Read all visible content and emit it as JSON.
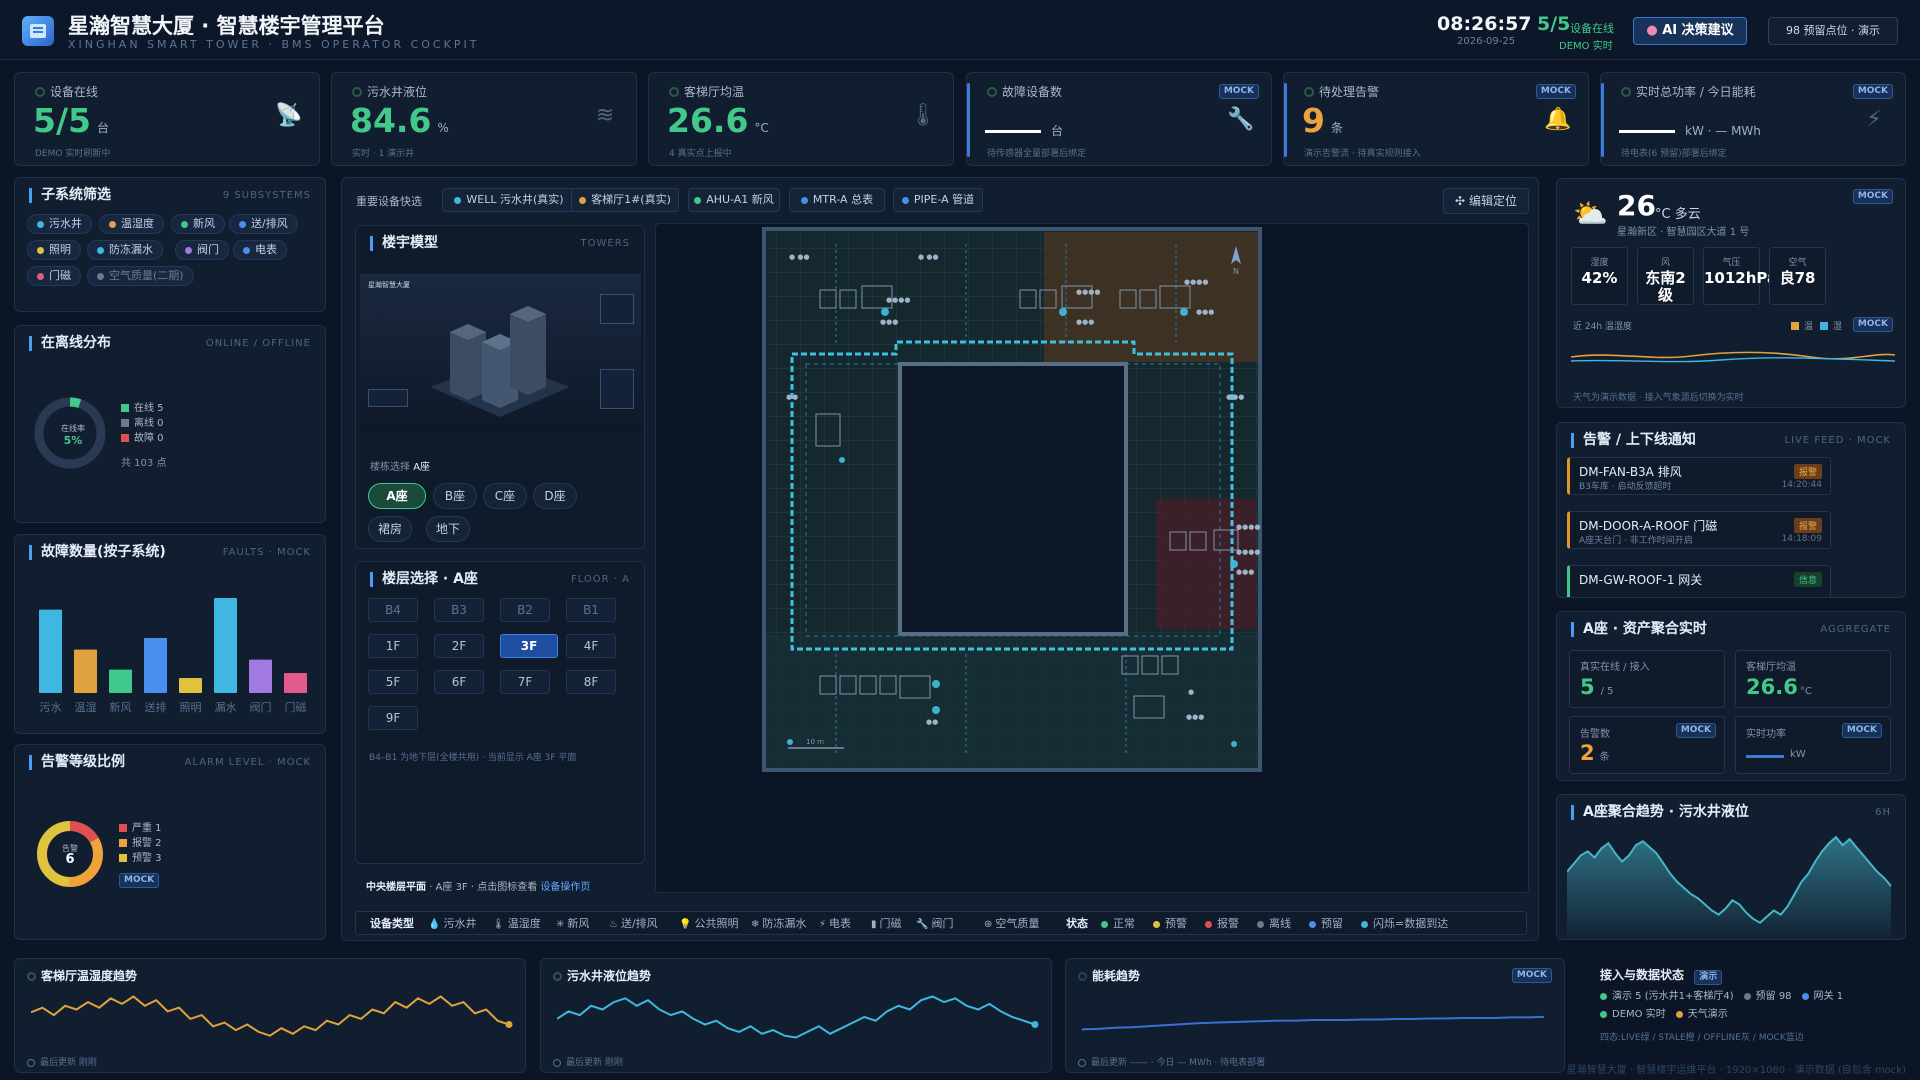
{
  "header": {
    "title": "星瀚智慧大厦 · 智慧楼宇管理平台",
    "subtitle": "XINGHAN SMART TOWER · BMS OPERATOR COCKPIT",
    "time": "08:26:57",
    "date": "2026-09-25",
    "online_ratio": "5/5",
    "online_label": "设备在线",
    "online_sub": "DEMO 实时",
    "ai_button": "AI 决策建议",
    "demo_button": "98 预留点位 · 演示"
  },
  "kpis": [
    {
      "label": "设备在线",
      "value": "5/5",
      "unit": "台",
      "foot": "DEMO 实时刷新中",
      "color": "#42c98a",
      "icon": "satellite-icon"
    },
    {
      "label": "污水井液位",
      "value": "84.6",
      "unit": "%",
      "foot": "实时 · 1 演示井",
      "color": "#42c98a",
      "icon": "water-icon"
    },
    {
      "label": "客梯厅均温",
      "value": "26.6",
      "unit": "°C",
      "foot": "4 真实点上报中",
      "color": "#42c98a",
      "icon": "thermometer-icon"
    },
    {
      "label": "故障设备数",
      "value": "",
      "unit": "台",
      "foot": "待传感器全量部署后绑定",
      "mock": "MOCK",
      "icon": "wrench-icon"
    },
    {
      "label": "待处理告警",
      "value": "9",
      "unit": "条",
      "foot": "演示告警流 · 待真实规则接入",
      "mock": "MOCK",
      "color": "#f0a23a",
      "icon": "bell-icon"
    },
    {
      "label": "实时总功率 / 今日能耗",
      "value": "",
      "unit": "kW · — MWh",
      "foot": "待电表(6 预留)部署后绑定",
      "mock": "MOCK",
      "icon": "lightning-icon"
    }
  ],
  "subsystem_filter": {
    "title": "子系统筛选",
    "sub": "9 SUBSYSTEMS",
    "chips": [
      {
        "label": "污水井",
        "color": "#3fb7e0"
      },
      {
        "label": "温湿度",
        "color": "#e0a23f"
      },
      {
        "label": "新风",
        "color": "#3fc98a"
      },
      {
        "label": "送/排风",
        "color": "#4a8ff0"
      },
      {
        "label": "照明",
        "color": "#e0c23f"
      },
      {
        "label": "防冻漏水",
        "color": "#3fb7e0"
      },
      {
        "label": "阀门",
        "color": "#a07ae0"
      },
      {
        "label": "电表",
        "color": "#4a8ff0"
      },
      {
        "label": "门磁",
        "color": "#e05a8a"
      },
      {
        "label": "空气质量(二期)",
        "color": "#6b7a90"
      }
    ]
  },
  "online_dist": {
    "title": "在离线分布",
    "sub": "ONLINE / OFFLINE",
    "donut_label": "在线率",
    "donut_value": "5%",
    "legend": [
      {
        "label": "在线 5",
        "color": "#42c98a"
      },
      {
        "label": "离线 0",
        "color": "#6b7a90"
      },
      {
        "label": "故障 0",
        "color": "#e05050"
      }
    ],
    "total": "共 103 点"
  },
  "faults": {
    "title": "故障数量(按子系统)",
    "sub": "FAULTS · MOCK",
    "chart_data": {
      "type": "bar",
      "categories": [
        "污水",
        "温湿",
        "新风",
        "送排",
        "照明",
        "漏水",
        "阀门",
        "门磁"
      ],
      "values": [
        5,
        2.6,
        1.4,
        3.3,
        0.9,
        5.7,
        2,
        1.2
      ],
      "colors": [
        "#3fb7e0",
        "#e0a23f",
        "#3fc98a",
        "#4a8ff0",
        "#e0c23f",
        "#3fb7e0",
        "#a07ae0",
        "#e05a8a"
      ]
    }
  },
  "alarm_level": {
    "title": "告警等级比例",
    "sub": "ALARM LEVEL · MOCK",
    "donut_label": "告警",
    "donut_value": "6",
    "legend": [
      {
        "label": "严重 1",
        "color": "#e05050",
        "value": 1
      },
      {
        "label": "报警 2",
        "color": "#f0a23a",
        "value": 2
      },
      {
        "label": "预警 3",
        "color": "#e0c23f",
        "value": 3
      }
    ],
    "mock": "MOCK"
  },
  "quick": {
    "label": "重要设备快选",
    "items": [
      {
        "label": "WELL 污水井(真实)",
        "color": "#3fb7e0"
      },
      {
        "label": "客梯厅1#(真实)",
        "color": "#e0a23f"
      },
      {
        "label": "AHU-A1 新风",
        "color": "#3fc98a"
      },
      {
        "label": "MTR-A 总表",
        "color": "#4a8ff0"
      },
      {
        "label": "PIPE-A 管道",
        "color": "#4a8ff0"
      }
    ],
    "edit_button": "编辑定位"
  },
  "tower": {
    "title": "楼宇模型",
    "sub": "TOWERS",
    "thumb_label": "星瀚智慧大厦",
    "select_label": "楼栋选择",
    "select_value": "A座",
    "buttons": [
      "A座",
      "B座",
      "C座",
      "D座",
      "裙房",
      "地下"
    ]
  },
  "floors": {
    "title": "楼层选择 · A座",
    "sub": "FLOOR · A",
    "rows": [
      [
        "B4",
        "B3",
        "B2",
        "B1"
      ],
      [
        "1F",
        "2F",
        "3F",
        "4F"
      ],
      [
        "5F",
        "6F",
        "7F",
        "8F"
      ],
      [
        "9F"
      ]
    ],
    "selected": "3F",
    "note": "B4–B1 为地下层(全楼共用) · 当前显示 A座 3F 平面"
  },
  "plan": {
    "footer_prefix": "中央楼层平面",
    "footer_mid": "· A座 3F · 点击图标查看",
    "footer_link": "设备操作页",
    "north": "N",
    "scale": "10 m"
  },
  "device_types": {
    "label": "设备类型",
    "items": [
      {
        "label": "污水井",
        "icon": "drop-icon",
        "glyph": "💧"
      },
      {
        "label": "温湿度",
        "icon": "thermometer-icon",
        "glyph": "🌡"
      },
      {
        "label": "新风",
        "icon": "fan-icon",
        "glyph": "✳"
      },
      {
        "label": "送/排风",
        "icon": "fan-icon",
        "glyph": "♨"
      },
      {
        "label": "公共照明",
        "icon": "bulb-icon",
        "glyph": "💡"
      },
      {
        "label": "防冻漏水",
        "icon": "snowflake-icon",
        "glyph": "❄"
      },
      {
        "label": "电表",
        "icon": "lightning-icon",
        "glyph": "⚡"
      },
      {
        "label": "门磁",
        "icon": "door-icon",
        "glyph": "▮"
      },
      {
        "label": "阀门",
        "icon": "wrench-icon",
        "glyph": "🔧"
      },
      {
        "label": "空气质量",
        "icon": "air-icon",
        "glyph": "⊛"
      }
    ],
    "status_label": "状态",
    "statuses": [
      {
        "label": "正常",
        "color": "#42c98a"
      },
      {
        "label": "预警",
        "color": "#e0c23f"
      },
      {
        "label": "报警",
        "color": "#e05050"
      },
      {
        "label": "离线",
        "color": "#6b7a90"
      },
      {
        "label": "预留",
        "color": "#4a8ff0"
      },
      {
        "label": "闪烁=数据到达",
        "color": "#3fb7e0"
      }
    ]
  },
  "weather": {
    "temp": "26",
    "desc": "°C 多云",
    "location": "星瀚新区 · 智慧园区大道 1 号",
    "mock": "MOCK",
    "stats": [
      {
        "k": "湿度",
        "v": "42%"
      },
      {
        "k": "风",
        "v": "东南2级"
      },
      {
        "k": "气压",
        "v": "1012hPa"
      },
      {
        "k": "空气",
        "v": "良78"
      }
    ],
    "trend_label": "近 24h 温湿度",
    "legend_temp": "温",
    "legend_hum": "湿",
    "note": "天气为演示数据 · 接入气象源后切换为实时"
  },
  "alarms": {
    "title": "告警 / 上下线通知",
    "sub": "LIVE FEED · MOCK",
    "items": [
      {
        "title": "DM-FAN-B3A 排风",
        "sub": "B3车库 · 启动反馈超时",
        "badge": "报警",
        "time": "14:20:44"
      },
      {
        "title": "DM-DOOR-A-ROOF 门磁",
        "sub": "A座天台门 · 非工作时间开启",
        "badge": "报警",
        "time": "14:18:09"
      },
      {
        "title": "DM-GW-ROOF-1 网关",
        "sub": "",
        "badge": "信息",
        "time": ""
      }
    ]
  },
  "aggregate": {
    "title": "A座 · 资产聚合实时",
    "sub": "AGGREGATE",
    "online_label": "真实在线 / 接入",
    "online_value": "5",
    "online_total": "/ 5",
    "temp_label": "客梯厅均温",
    "temp_value": "26.6",
    "temp_unit": "°C",
    "alarm_label": "告警数",
    "alarm_value": "2",
    "alarm_unit": "条",
    "power_label": "实时功率",
    "power_unit": "kW",
    "mock": "MOCK"
  },
  "trend": {
    "title": "A座聚合趋势 · 污水井液位",
    "sub": "6H",
    "chart_data": {
      "type": "area",
      "values": [
        62,
        70,
        78,
        82,
        76,
        85,
        90,
        80,
        72,
        78,
        88,
        92,
        86,
        80,
        70,
        60,
        52,
        46,
        40,
        36,
        30,
        24,
        20,
        26,
        34,
        30,
        22,
        16,
        12,
        18,
        24,
        20,
        28,
        40,
        52,
        60,
        72,
        82,
        90,
        96,
        88,
        94,
        86,
        78,
        70,
        62,
        56,
        48
      ]
    }
  },
  "bottom": {
    "temp_title": "客梯厅温湿度趋势",
    "temp_foot": "最后更新 刚刚",
    "temp_chart": {
      "type": "line",
      "values": [
        55,
        60,
        52,
        62,
        58,
        66,
        60,
        70,
        64,
        72,
        62,
        68,
        56,
        60,
        48,
        52,
        40,
        44,
        36,
        42,
        34,
        30,
        38,
        32,
        40,
        36,
        46,
        42,
        52,
        48,
        58,
        54,
        66,
        60,
        70,
        64,
        72,
        62,
        66,
        54,
        58,
        46,
        42
      ]
    },
    "water_title": "污水井液位趋势",
    "water_foot": "最后更新 刚刚",
    "water_chart": {
      "type": "line",
      "values": [
        48,
        56,
        52,
        62,
        58,
        66,
        70,
        62,
        68,
        58,
        52,
        56,
        48,
        42,
        46,
        38,
        34,
        40,
        32,
        36,
        30,
        28,
        34,
        40,
        32,
        38,
        44,
        50,
        46,
        56,
        62,
        58,
        68,
        72,
        66,
        70,
        62,
        58,
        64,
        56,
        50,
        46,
        42
      ]
    },
    "energy_title": "能耗趋势",
    "energy_mock": "MOCK",
    "energy_foot": "最后更新 —— · 今日 — MWh · 待电表部署",
    "energy_chart": {
      "type": "line",
      "values": [
        30,
        31,
        33,
        34,
        36,
        38,
        40,
        42,
        43,
        44,
        45,
        46,
        47,
        47,
        48,
        48,
        48,
        49,
        49,
        50,
        50,
        51,
        51,
        52,
        52,
        52,
        53,
        53,
        54
      ]
    },
    "access_title": "接入与数据状态",
    "access_badge": "演示",
    "access_items": [
      {
        "label": "演示 5 (污水井1+客梯厅4)",
        "color": "#42c98a"
      },
      {
        "label": "预留 98",
        "color": "#6b7a90"
      },
      {
        "label": "网关 1",
        "color": "#4a8ff0"
      },
      {
        "label": "DEMO 实时",
        "color": "#42c98a"
      },
      {
        "label": "天气演示",
        "color": "#e0a23f"
      }
    ],
    "access_note": "四态:LIVE绿 / STALE橙 / OFFLINE灰 / MOCK蓝边",
    "footer": "星瀚智慧大厦 · 智慧楼宇运维平台 · 1920×1080 · 演示数据 (自包含 mock)"
  }
}
